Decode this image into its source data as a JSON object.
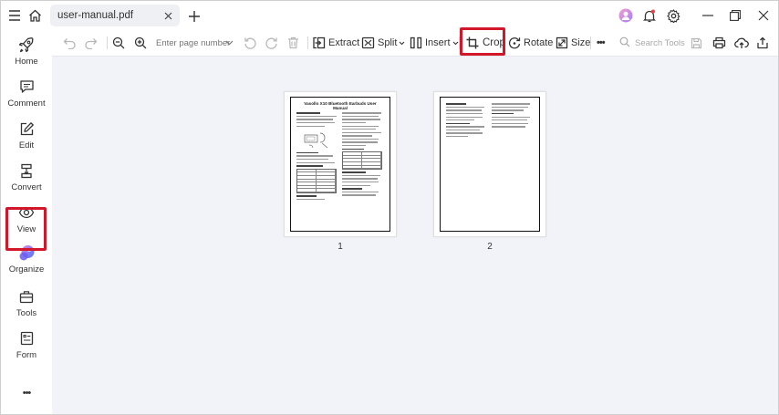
{
  "titlebar": {
    "tab_label": "user-manual.pdf",
    "icons": [
      "menu-icon",
      "home-icon",
      "close-icon",
      "plus-icon",
      "avatar-icon",
      "bell-icon",
      "gear-icon",
      "minimize-icon",
      "restore-icon",
      "close-icon"
    ]
  },
  "sidebar": {
    "items": [
      {
        "label": "Home",
        "icon": "rocket-icon"
      },
      {
        "label": "Comment",
        "icon": "comment-icon"
      },
      {
        "label": "Edit",
        "icon": "edit-icon"
      },
      {
        "label": "Convert",
        "icon": "convert-icon"
      },
      {
        "label": "View",
        "icon": "view-icon"
      },
      {
        "label": "Organize",
        "icon": "organize-icon"
      },
      {
        "label": "Tools",
        "icon": "tools-icon"
      },
      {
        "label": "Form",
        "icon": "form-icon"
      }
    ],
    "more": "•••",
    "active": "Organize"
  },
  "toolbar": {
    "page_placeholder": "Enter page number",
    "extract": "Extract",
    "split": "Split",
    "insert": "Insert",
    "crop": "Crop",
    "rotate": "Rotate",
    "size": "Size",
    "more": "•••",
    "search_placeholder": "Search Tools"
  },
  "pages": [
    {
      "number": "1",
      "title": "Vasollo X10 Bluetooth Earbuds User Manual"
    },
    {
      "number": "2"
    }
  ],
  "colors": {
    "highlight": "#d3172b",
    "accent": "#5a6cf0",
    "canvas": "#f1f3f8"
  }
}
